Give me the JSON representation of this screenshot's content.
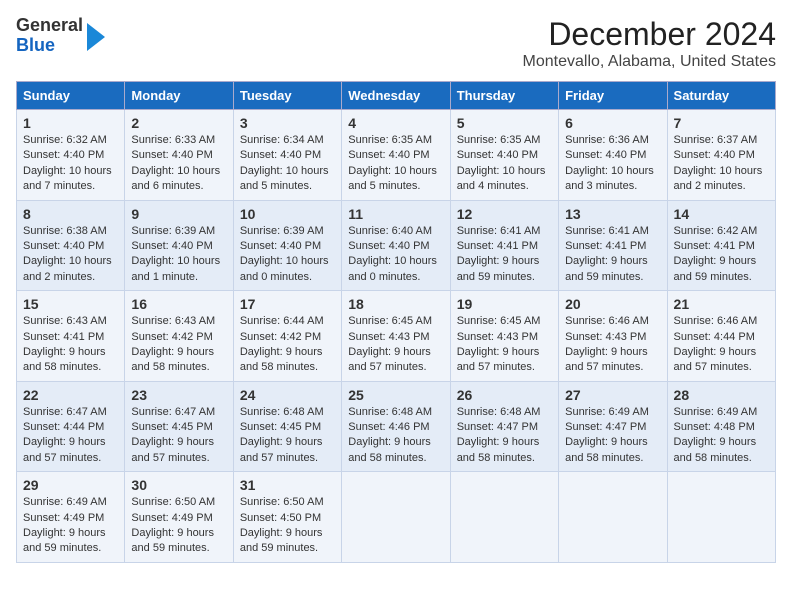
{
  "logo": {
    "line1": "General",
    "line2": "Blue"
  },
  "title": "December 2024",
  "subtitle": "Montevallo, Alabama, United States",
  "days_of_week": [
    "Sunday",
    "Monday",
    "Tuesday",
    "Wednesday",
    "Thursday",
    "Friday",
    "Saturday"
  ],
  "weeks": [
    [
      {
        "day": 1,
        "lines": [
          "Sunrise: 6:32 AM",
          "Sunset: 4:40 PM",
          "Daylight: 10 hours",
          "and 7 minutes."
        ]
      },
      {
        "day": 2,
        "lines": [
          "Sunrise: 6:33 AM",
          "Sunset: 4:40 PM",
          "Daylight: 10 hours",
          "and 6 minutes."
        ]
      },
      {
        "day": 3,
        "lines": [
          "Sunrise: 6:34 AM",
          "Sunset: 4:40 PM",
          "Daylight: 10 hours",
          "and 5 minutes."
        ]
      },
      {
        "day": 4,
        "lines": [
          "Sunrise: 6:35 AM",
          "Sunset: 4:40 PM",
          "Daylight: 10 hours",
          "and 5 minutes."
        ]
      },
      {
        "day": 5,
        "lines": [
          "Sunrise: 6:35 AM",
          "Sunset: 4:40 PM",
          "Daylight: 10 hours",
          "and 4 minutes."
        ]
      },
      {
        "day": 6,
        "lines": [
          "Sunrise: 6:36 AM",
          "Sunset: 4:40 PM",
          "Daylight: 10 hours",
          "and 3 minutes."
        ]
      },
      {
        "day": 7,
        "lines": [
          "Sunrise: 6:37 AM",
          "Sunset: 4:40 PM",
          "Daylight: 10 hours",
          "and 2 minutes."
        ]
      }
    ],
    [
      {
        "day": 8,
        "lines": [
          "Sunrise: 6:38 AM",
          "Sunset: 4:40 PM",
          "Daylight: 10 hours",
          "and 2 minutes."
        ]
      },
      {
        "day": 9,
        "lines": [
          "Sunrise: 6:39 AM",
          "Sunset: 4:40 PM",
          "Daylight: 10 hours",
          "and 1 minute."
        ]
      },
      {
        "day": 10,
        "lines": [
          "Sunrise: 6:39 AM",
          "Sunset: 4:40 PM",
          "Daylight: 10 hours",
          "and 0 minutes."
        ]
      },
      {
        "day": 11,
        "lines": [
          "Sunrise: 6:40 AM",
          "Sunset: 4:40 PM",
          "Daylight: 10 hours",
          "and 0 minutes."
        ]
      },
      {
        "day": 12,
        "lines": [
          "Sunrise: 6:41 AM",
          "Sunset: 4:41 PM",
          "Daylight: 9 hours",
          "and 59 minutes."
        ]
      },
      {
        "day": 13,
        "lines": [
          "Sunrise: 6:41 AM",
          "Sunset: 4:41 PM",
          "Daylight: 9 hours",
          "and 59 minutes."
        ]
      },
      {
        "day": 14,
        "lines": [
          "Sunrise: 6:42 AM",
          "Sunset: 4:41 PM",
          "Daylight: 9 hours",
          "and 59 minutes."
        ]
      }
    ],
    [
      {
        "day": 15,
        "lines": [
          "Sunrise: 6:43 AM",
          "Sunset: 4:41 PM",
          "Daylight: 9 hours",
          "and 58 minutes."
        ]
      },
      {
        "day": 16,
        "lines": [
          "Sunrise: 6:43 AM",
          "Sunset: 4:42 PM",
          "Daylight: 9 hours",
          "and 58 minutes."
        ]
      },
      {
        "day": 17,
        "lines": [
          "Sunrise: 6:44 AM",
          "Sunset: 4:42 PM",
          "Daylight: 9 hours",
          "and 58 minutes."
        ]
      },
      {
        "day": 18,
        "lines": [
          "Sunrise: 6:45 AM",
          "Sunset: 4:43 PM",
          "Daylight: 9 hours",
          "and 57 minutes."
        ]
      },
      {
        "day": 19,
        "lines": [
          "Sunrise: 6:45 AM",
          "Sunset: 4:43 PM",
          "Daylight: 9 hours",
          "and 57 minutes."
        ]
      },
      {
        "day": 20,
        "lines": [
          "Sunrise: 6:46 AM",
          "Sunset: 4:43 PM",
          "Daylight: 9 hours",
          "and 57 minutes."
        ]
      },
      {
        "day": 21,
        "lines": [
          "Sunrise: 6:46 AM",
          "Sunset: 4:44 PM",
          "Daylight: 9 hours",
          "and 57 minutes."
        ]
      }
    ],
    [
      {
        "day": 22,
        "lines": [
          "Sunrise: 6:47 AM",
          "Sunset: 4:44 PM",
          "Daylight: 9 hours",
          "and 57 minutes."
        ]
      },
      {
        "day": 23,
        "lines": [
          "Sunrise: 6:47 AM",
          "Sunset: 4:45 PM",
          "Daylight: 9 hours",
          "and 57 minutes."
        ]
      },
      {
        "day": 24,
        "lines": [
          "Sunrise: 6:48 AM",
          "Sunset: 4:45 PM",
          "Daylight: 9 hours",
          "and 57 minutes."
        ]
      },
      {
        "day": 25,
        "lines": [
          "Sunrise: 6:48 AM",
          "Sunset: 4:46 PM",
          "Daylight: 9 hours",
          "and 58 minutes."
        ]
      },
      {
        "day": 26,
        "lines": [
          "Sunrise: 6:48 AM",
          "Sunset: 4:47 PM",
          "Daylight: 9 hours",
          "and 58 minutes."
        ]
      },
      {
        "day": 27,
        "lines": [
          "Sunrise: 6:49 AM",
          "Sunset: 4:47 PM",
          "Daylight: 9 hours",
          "and 58 minutes."
        ]
      },
      {
        "day": 28,
        "lines": [
          "Sunrise: 6:49 AM",
          "Sunset: 4:48 PM",
          "Daylight: 9 hours",
          "and 58 minutes."
        ]
      }
    ],
    [
      {
        "day": 29,
        "lines": [
          "Sunrise: 6:49 AM",
          "Sunset: 4:49 PM",
          "Daylight: 9 hours",
          "and 59 minutes."
        ]
      },
      {
        "day": 30,
        "lines": [
          "Sunrise: 6:50 AM",
          "Sunset: 4:49 PM",
          "Daylight: 9 hours",
          "and 59 minutes."
        ]
      },
      {
        "day": 31,
        "lines": [
          "Sunrise: 6:50 AM",
          "Sunset: 4:50 PM",
          "Daylight: 9 hours",
          "and 59 minutes."
        ]
      },
      null,
      null,
      null,
      null
    ]
  ]
}
